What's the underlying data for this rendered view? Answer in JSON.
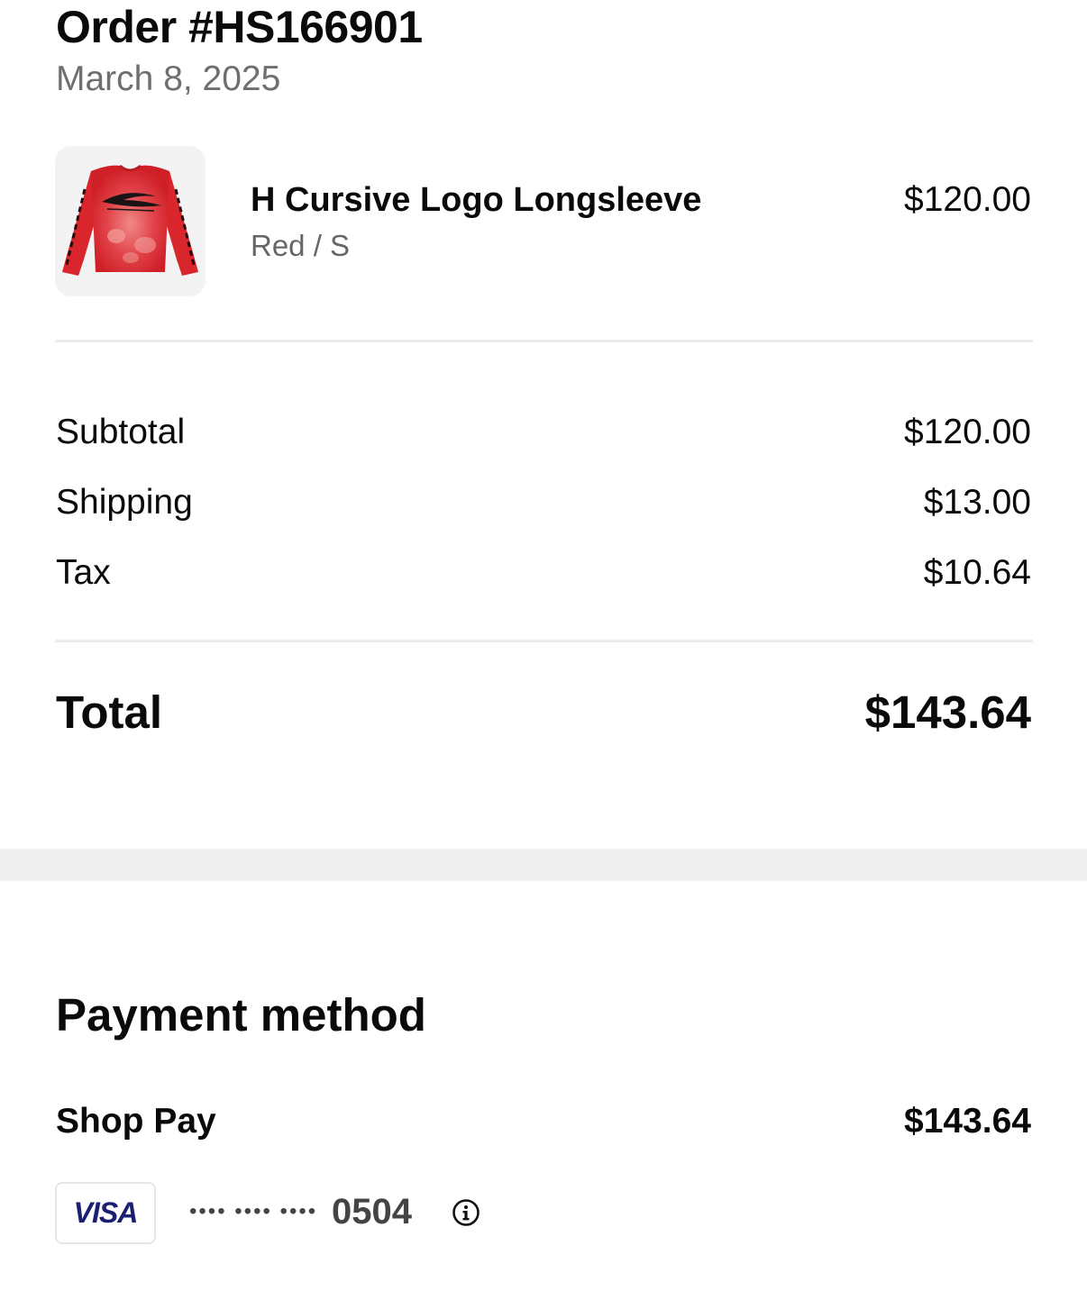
{
  "order": {
    "title": "Order #HS166901",
    "date": "March 8, 2025"
  },
  "item": {
    "name": "H Cursive Logo Longsleeve",
    "variant": "Red / S",
    "price": "$120.00",
    "image_icon": "red-longsleeve-shirt-image"
  },
  "summary": {
    "subtotal_label": "Subtotal",
    "subtotal_value": "$120.00",
    "shipping_label": "Shipping",
    "shipping_value": "$13.00",
    "tax_label": "Tax",
    "tax_value": "$10.64",
    "total_label": "Total",
    "total_value": "$143.64"
  },
  "payment": {
    "heading": "Payment method",
    "method_name": "Shop Pay",
    "amount": "$143.64",
    "card_brand": "VISA",
    "card_mask": "•••• •••• ••••",
    "card_last4": "0504",
    "info_icon": "info-icon"
  },
  "colors": {
    "text": "#0a0a0a",
    "muted": "#6f6f6f",
    "divider": "#ececec",
    "band": "#efefef",
    "visa_blue": "#1a1f71",
    "shirt_red": "#d8262c"
  }
}
